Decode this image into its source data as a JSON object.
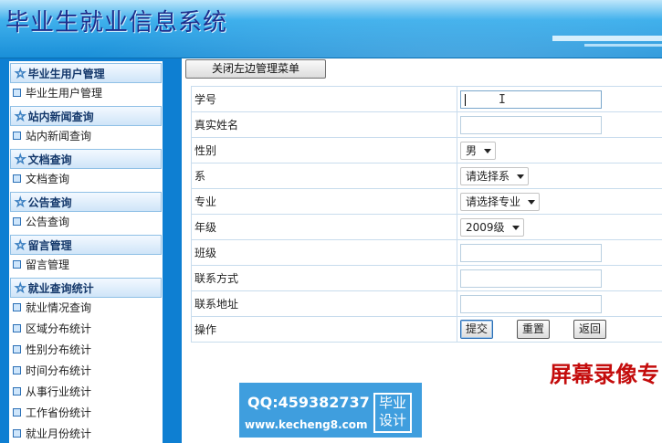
{
  "header": {
    "title": "毕业生就业信息系统"
  },
  "sidebar": {
    "groups": [
      {
        "title": "毕业生用户管理",
        "items": [
          "毕业生用户管理"
        ]
      },
      {
        "title": "站内新闻查询",
        "items": [
          "站内新闻查询"
        ]
      },
      {
        "title": "文档查询",
        "items": [
          "文档查询"
        ]
      },
      {
        "title": "公告查询",
        "items": [
          "公告查询"
        ]
      },
      {
        "title": "留言管理",
        "items": [
          "留言管理"
        ]
      },
      {
        "title": "就业查询统计",
        "items": [
          "就业情况查询",
          "区域分布统计",
          "性别分布统计",
          "时间分布统计",
          "从事行业统计",
          "工作省份统计",
          "就业月份统计"
        ]
      }
    ]
  },
  "toolbar": {
    "toggle_label": "关闭左边管理菜单"
  },
  "form": {
    "fields": {
      "student_id": {
        "label": "学号",
        "value": ""
      },
      "real_name": {
        "label": "真实姓名",
        "value": ""
      },
      "gender": {
        "label": "性别",
        "selected": "男"
      },
      "department": {
        "label": "系",
        "selected": "请选择系"
      },
      "major": {
        "label": "专业",
        "selected": "请选择专业"
      },
      "grade": {
        "label": "年级",
        "selected": "2009级"
      },
      "class": {
        "label": "班级",
        "value": ""
      },
      "contact": {
        "label": "联系方式",
        "value": ""
      },
      "address": {
        "label": "联系地址",
        "value": ""
      }
    },
    "actions": {
      "label": "操作",
      "submit": "提交",
      "reset": "重置",
      "back": "返回"
    }
  },
  "watermark": {
    "text": "屏幕录像专"
  },
  "badge": {
    "qq": "QQ:459382737",
    "url": "www.kecheng8.com",
    "tag_line1": "毕业",
    "tag_line2": "设计"
  },
  "colors": {
    "header": "#1a8fd8",
    "sidebar": "#0e7fd2",
    "watermark": "#c40c0c",
    "badge": "#3f9ede"
  }
}
